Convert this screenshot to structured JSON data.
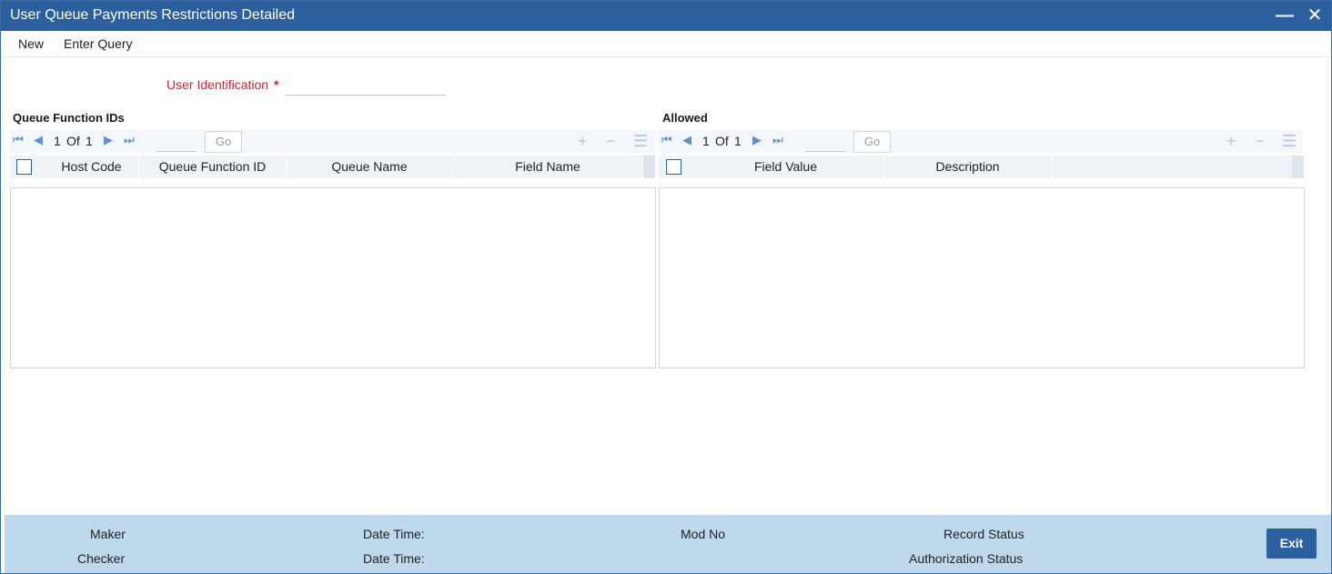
{
  "window": {
    "title": "User Queue Payments Restrictions Detailed",
    "minimize_symbol": "—",
    "close_symbol": "✕"
  },
  "menu": {
    "new_label": "New",
    "enter_query_label": "Enter Query"
  },
  "form": {
    "user_id_label": "User Identification",
    "required_marker": "*",
    "user_id_value": ""
  },
  "queue_function_ids": {
    "title": "Queue Function IDs",
    "page_current": "1",
    "page_of": "Of",
    "page_total": "1",
    "go_label": "Go",
    "columns": [
      "Host Code",
      "Queue Function ID",
      "Queue Name",
      "Field Name"
    ],
    "rows": []
  },
  "allowed": {
    "title": "Allowed",
    "page_current": "1",
    "page_of": "Of",
    "page_total": "1",
    "go_label": "Go",
    "columns": [
      "Field Value",
      "Description"
    ],
    "rows": []
  },
  "footer": {
    "maker_label": "Maker",
    "checker_label": "Checker",
    "date_time_label_1": "Date Time:",
    "date_time_label_2": "Date Time:",
    "mod_no_label": "Mod No",
    "record_status_label": "Record Status",
    "authorization_status_label": "Authorization Status",
    "exit_label": "Exit"
  },
  "colors": {
    "titlebar": "#2c5f9e",
    "required": "#e01f26",
    "footer": "#bed8ec",
    "nav_icon": "#5f8fce"
  },
  "icons": {
    "first_page": "first-page-icon",
    "prev_page": "prev-page-icon",
    "next_page": "next-page-icon",
    "last_page": "last-page-icon",
    "add_row": "add-row-icon",
    "delete_row": "delete-row-icon",
    "single_view": "single-view-icon"
  }
}
